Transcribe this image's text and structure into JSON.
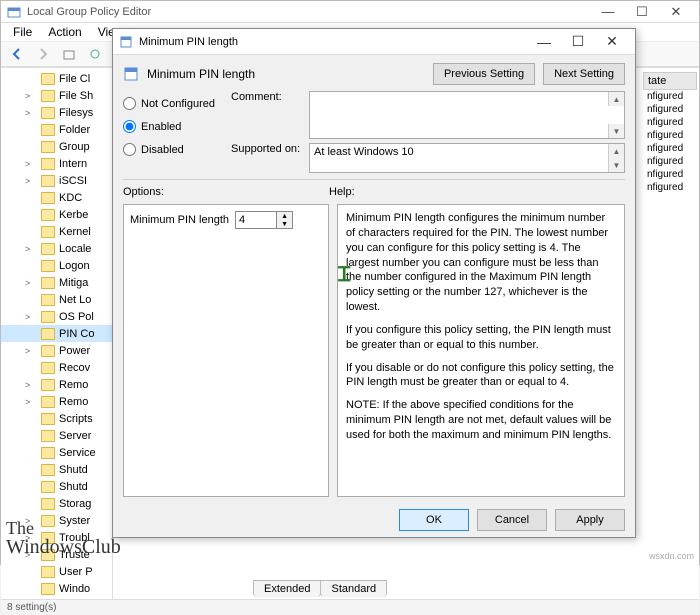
{
  "window": {
    "title": "Local Group Policy Editor"
  },
  "menubar": {
    "file": "File",
    "action": "Action",
    "view": "View"
  },
  "dialog": {
    "title": "Minimum PIN length",
    "header_title": "Minimum PIN length",
    "prev_btn": "Previous Setting",
    "next_btn": "Next Setting",
    "radio_not_configured": "Not Configured",
    "radio_enabled": "Enabled",
    "radio_disabled": "Disabled",
    "comment_label": "Comment:",
    "comment_value": "",
    "supported_label": "Supported on:",
    "supported_value": "At least Windows 10",
    "options_label": "Options:",
    "help_label": "Help:",
    "option_name": "Minimum PIN length",
    "option_value": "4",
    "help_p1": "Minimum PIN length configures the minimum number of characters required for the PIN.  The lowest number you can configure for this policy setting is 4.  The largest number you can configure must be less than the number configured in the Maximum PIN length policy setting or the number 127, whichever is the lowest.",
    "help_p2": "If you configure this policy setting, the PIN length must be greater than or equal to this number.",
    "help_p3": "If you disable or do not configure this policy setting, the PIN length must be greater than or equal to 4.",
    "help_p4": "NOTE: If the above specified conditions for the minimum PIN length are not met, default values will be used for both the maximum and minimum PIN lengths.",
    "btn_ok": "OK",
    "btn_cancel": "Cancel",
    "btn_apply": "Apply"
  },
  "tree": {
    "items": [
      {
        "label": "File Cl",
        "exp": ""
      },
      {
        "label": "File Sh",
        "exp": ">"
      },
      {
        "label": "Filesys",
        "exp": ">"
      },
      {
        "label": "Folder",
        "exp": ""
      },
      {
        "label": "Group",
        "exp": ""
      },
      {
        "label": "Intern",
        "exp": ">"
      },
      {
        "label": "iSCSI",
        "exp": ">"
      },
      {
        "label": "KDC",
        "exp": ""
      },
      {
        "label": "Kerbe",
        "exp": ""
      },
      {
        "label": "Kernel",
        "exp": ""
      },
      {
        "label": "Locale",
        "exp": ">"
      },
      {
        "label": "Logon",
        "exp": ""
      },
      {
        "label": "Mitiga",
        "exp": ">"
      },
      {
        "label": "Net Lo",
        "exp": ""
      },
      {
        "label": "OS Pol",
        "exp": ">"
      },
      {
        "label": "PIN Co",
        "exp": "",
        "selected": true
      },
      {
        "label": "Power",
        "exp": ">"
      },
      {
        "label": "Recov",
        "exp": ""
      },
      {
        "label": "Remo",
        "exp": ">"
      },
      {
        "label": "Remo",
        "exp": ">"
      },
      {
        "label": "Scripts",
        "exp": ""
      },
      {
        "label": "Server",
        "exp": ""
      },
      {
        "label": "Service",
        "exp": ""
      },
      {
        "label": "Shutd",
        "exp": ""
      },
      {
        "label": "Shutd",
        "exp": ""
      },
      {
        "label": "Storag",
        "exp": ""
      },
      {
        "label": "Syster",
        "exp": ">"
      },
      {
        "label": "Troubl",
        "exp": ">"
      },
      {
        "label": "Truste",
        "exp": ">"
      },
      {
        "label": "User P",
        "exp": ""
      },
      {
        "label": "Windo",
        "exp": ""
      }
    ]
  },
  "settings_list": {
    "header": "tate",
    "rows": [
      "nfigured",
      "nfigured",
      "nfigured",
      "nfigured",
      "nfigured",
      "nfigured",
      "nfigured",
      "nfigured"
    ]
  },
  "tabs": {
    "extended": "Extended",
    "standard": "Standard"
  },
  "statusbar": "8 setting(s)",
  "watermark": {
    "l1": "The",
    "l2": "WindowsClub",
    "right": "wsxdn.com"
  }
}
